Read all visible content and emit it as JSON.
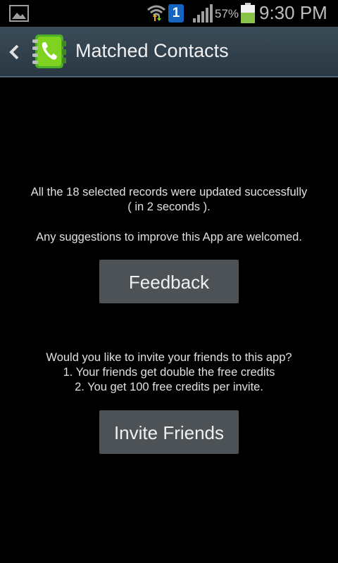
{
  "status_bar": {
    "notification_badge": "1",
    "battery_percent": "57%",
    "time": "9:30 PM",
    "icons": [
      "gallery-icon",
      "wifi-icon",
      "signal-icon",
      "battery-icon"
    ],
    "battery_level": 0.57
  },
  "action_bar": {
    "title": "Matched Contacts",
    "back_icon": "chevron-left-icon",
    "app_icon": "contacts-phone-book-icon",
    "colors": {
      "background": "#33434f",
      "app_icon": "#7ed321"
    }
  },
  "content": {
    "result_line1": "All the 18 selected records were updated successfully",
    "result_line2": "( in 2 seconds ).",
    "suggestion": "Any suggestions to improve this App are welcomed.",
    "feedback_button": "Feedback",
    "invite_line1": "Would you like to invite your friends to this app?",
    "invite_line2": "1. Your friends get double the free credits",
    "invite_line3": "2. You get 100 free credits per invite.",
    "invite_button": "Invite Friends"
  }
}
